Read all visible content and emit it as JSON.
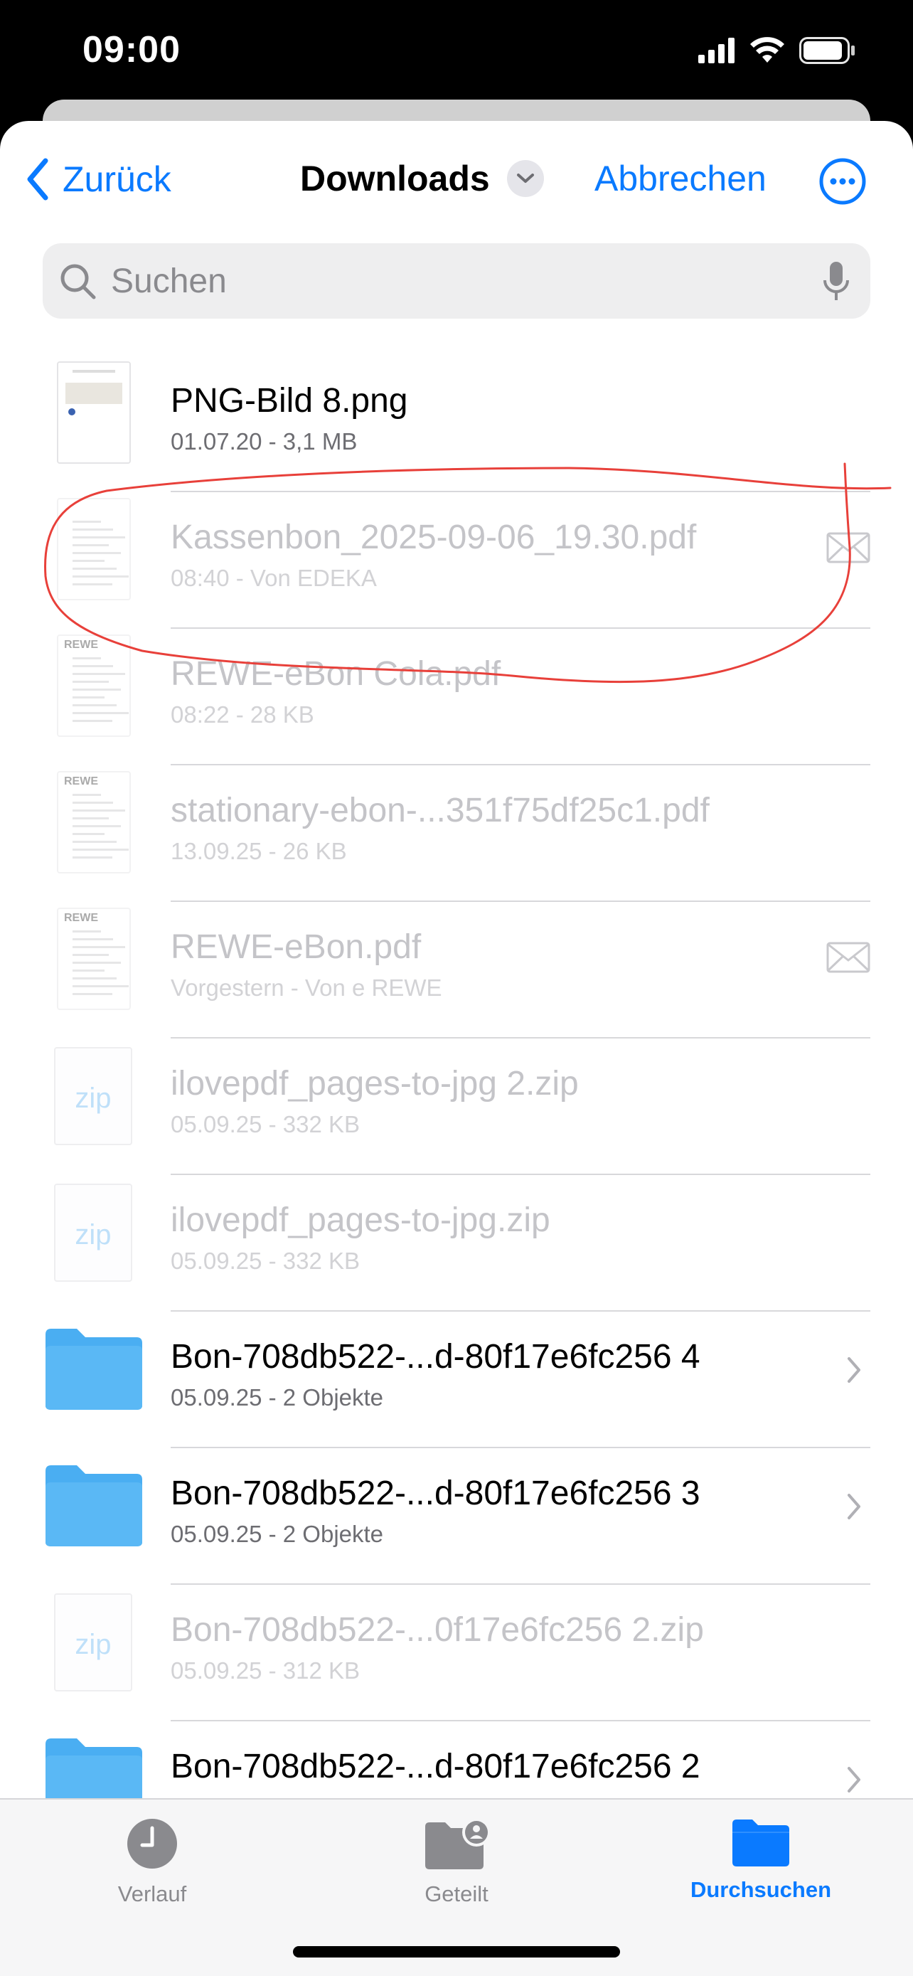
{
  "status": {
    "time": "09:00"
  },
  "nav": {
    "back_label": "Zurück",
    "title": "Downloads",
    "cancel_label": "Abbrechen"
  },
  "search": {
    "placeholder": "Suchen"
  },
  "files": [
    {
      "name": "PNG-Bild 8.png",
      "meta": "01.07.20 - 3,1 MB",
      "kind": "image",
      "dimmed": false
    },
    {
      "name": "Kassenbon_2025-09-06_19.30.pdf",
      "meta": "08:40 - Von EDEKA",
      "kind": "receipt",
      "dimmed": true,
      "trailing": "mail-icon",
      "annotated": true
    },
    {
      "name": "REWE-eBon Cola.pdf",
      "meta": "08:22 - 28 KB",
      "kind": "rewe",
      "thumb_text": "REWE",
      "dimmed": true
    },
    {
      "name": "stationary-ebon-...351f75df25c1.pdf",
      "meta": "13.09.25 - 26 KB",
      "kind": "rewe",
      "thumb_text": "REWE",
      "dimmed": true
    },
    {
      "name": "REWE-eBon.pdf",
      "meta": "Vorgestern - Von e REWE",
      "kind": "rewe",
      "thumb_text": "REWE",
      "dimmed": true,
      "trailing": "mail-icon"
    },
    {
      "name": "ilovepdf_pages-to-jpg 2.zip",
      "meta": "05.09.25 - 332 KB",
      "kind": "zip",
      "thumb_text": "zip",
      "dimmed": true
    },
    {
      "name": "ilovepdf_pages-to-jpg.zip",
      "meta": "05.09.25 - 332 KB",
      "kind": "zip",
      "thumb_text": "zip",
      "dimmed": true
    },
    {
      "name": "Bon-708db522-...d-80f17e6fc256 4",
      "meta": "05.09.25 - 2 Objekte",
      "kind": "folder",
      "dimmed": false,
      "trailing": "chevron-right-icon"
    },
    {
      "name": "Bon-708db522-...d-80f17e6fc256 3",
      "meta": "05.09.25 - 2 Objekte",
      "kind": "folder",
      "dimmed": false,
      "trailing": "chevron-right-icon"
    },
    {
      "name": "Bon-708db522-...0f17e6fc256 2.zip",
      "meta": "05.09.25 - 312 KB",
      "kind": "zip",
      "thumb_text": "zip",
      "dimmed": true
    },
    {
      "name": "Bon-708db522-...d-80f17e6fc256 2",
      "meta": "",
      "kind": "folder",
      "dimmed": false,
      "trailing": "chevron-right-icon"
    }
  ],
  "tabs": [
    {
      "label": "Verlauf",
      "icon": "clock-icon",
      "active": false
    },
    {
      "label": "Geteilt",
      "icon": "shared-folder-icon",
      "active": false
    },
    {
      "label": "Durchsuchen",
      "icon": "folder-icon",
      "active": true
    }
  ],
  "colors": {
    "accent": "#0a7aff",
    "annotation": "#e8403a",
    "folder": "#5ab8f5"
  }
}
